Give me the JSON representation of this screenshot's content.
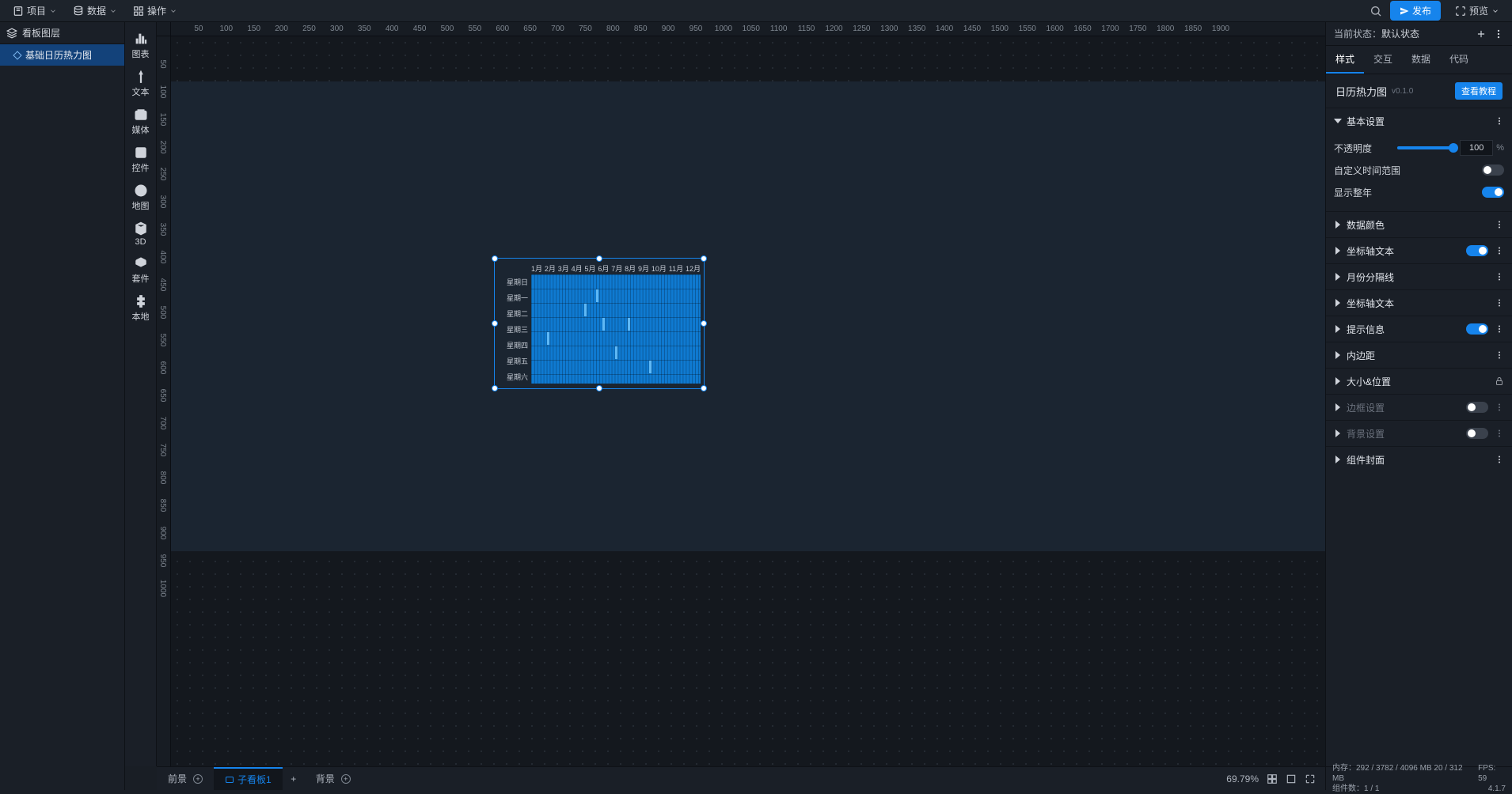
{
  "topbar": {
    "project": "项目",
    "data": "数据",
    "ops": "操作",
    "publish": "发布",
    "preview": "预览"
  },
  "left_panel": {
    "title": "看板图层",
    "items": [
      {
        "label": "基础日历热力图"
      }
    ]
  },
  "toolstrip": [
    {
      "key": "chart",
      "label": "图表"
    },
    {
      "key": "text",
      "label": "文本"
    },
    {
      "key": "media",
      "label": "媒体"
    },
    {
      "key": "widget",
      "label": "控件"
    },
    {
      "key": "map",
      "label": "地图"
    },
    {
      "key": "3d",
      "label": "3D"
    },
    {
      "key": "suite",
      "label": "套件"
    },
    {
      "key": "local",
      "label": "本地"
    }
  ],
  "ruler_marks_h": [
    50,
    100,
    150,
    200,
    250,
    300,
    350,
    400,
    450,
    500,
    550,
    600,
    650,
    700,
    750,
    800,
    850,
    900,
    950,
    1000,
    1050,
    1100,
    1150,
    1200,
    1250,
    1300,
    1350,
    1400,
    1450,
    1500,
    1550,
    1600,
    1650,
    1700,
    1750,
    1800,
    1850,
    1900
  ],
  "ruler_marks_v": [
    50,
    100,
    150,
    200,
    250,
    300,
    350,
    400,
    450,
    500,
    550,
    600,
    650,
    700,
    750,
    800,
    850,
    900,
    950,
    1000
  ],
  "footer": {
    "tabs": [
      {
        "key": "fg",
        "label": "前景"
      },
      {
        "key": "sub",
        "label": "子看板1"
      },
      {
        "key": "bg",
        "label": "背景"
      }
    ],
    "zoom": "69.79%"
  },
  "right": {
    "state_label": "当前状态：",
    "state_value": "默认状态",
    "tabs": [
      {
        "key": "style",
        "label": "样式"
      },
      {
        "key": "interact",
        "label": "交互"
      },
      {
        "key": "data",
        "label": "数据"
      },
      {
        "key": "code",
        "label": "代码"
      }
    ],
    "comp_name": "日历热力图",
    "comp_ver": "v0.1.0",
    "tutorial": "查看教程",
    "sections": {
      "basic": "基本设置",
      "opacity_label": "不透明度",
      "opacity_value": "100",
      "opacity_unit": "%",
      "custom_range": "自定义时间范围",
      "show_year": "显示整年",
      "data_color": "数据颜色",
      "axis_text1": "坐标轴文本",
      "month_line": "月份分隔线",
      "axis_text2": "坐标轴文本",
      "tooltip": "提示信息",
      "padding": "内边距",
      "size_pos": "大小&位置",
      "border": "边框设置",
      "bg": "背景设置",
      "cover": "组件封面"
    }
  },
  "status": {
    "mem_label": "内存：",
    "mem_value": "292 / 3782 / 4096 MB  20 / 312 MB",
    "fps_label": "FPS:",
    "fps_value": "59",
    "count_label": "组件数：",
    "count_value": "1 / 1",
    "app_ver": "4.1.7"
  },
  "chart_data": {
    "type": "heatmap",
    "title": "",
    "months": [
      "1月",
      "2月",
      "3月",
      "4月",
      "5月",
      "6月",
      "7月",
      "8月",
      "9月",
      "10月",
      "11月",
      "12月"
    ],
    "days": [
      "星期日",
      "星期一",
      "星期二",
      "星期三",
      "星期四",
      "星期五",
      "星期六"
    ],
    "notes": "Calendar heatmap for one year, 7 rows × ~53 columns; most cells baseline blue with a handful of lighter highlighted cells.",
    "highlights": [
      {
        "week": 5,
        "day": 4
      },
      {
        "week": 17,
        "day": 2
      },
      {
        "week": 21,
        "day": 1
      },
      {
        "week": 23,
        "day": 3
      },
      {
        "week": 27,
        "day": 5
      },
      {
        "week": 31,
        "day": 3
      },
      {
        "week": 38,
        "day": 6
      }
    ],
    "base_color": "#0f7ad1",
    "highlight_color": "#5fb8f5"
  }
}
